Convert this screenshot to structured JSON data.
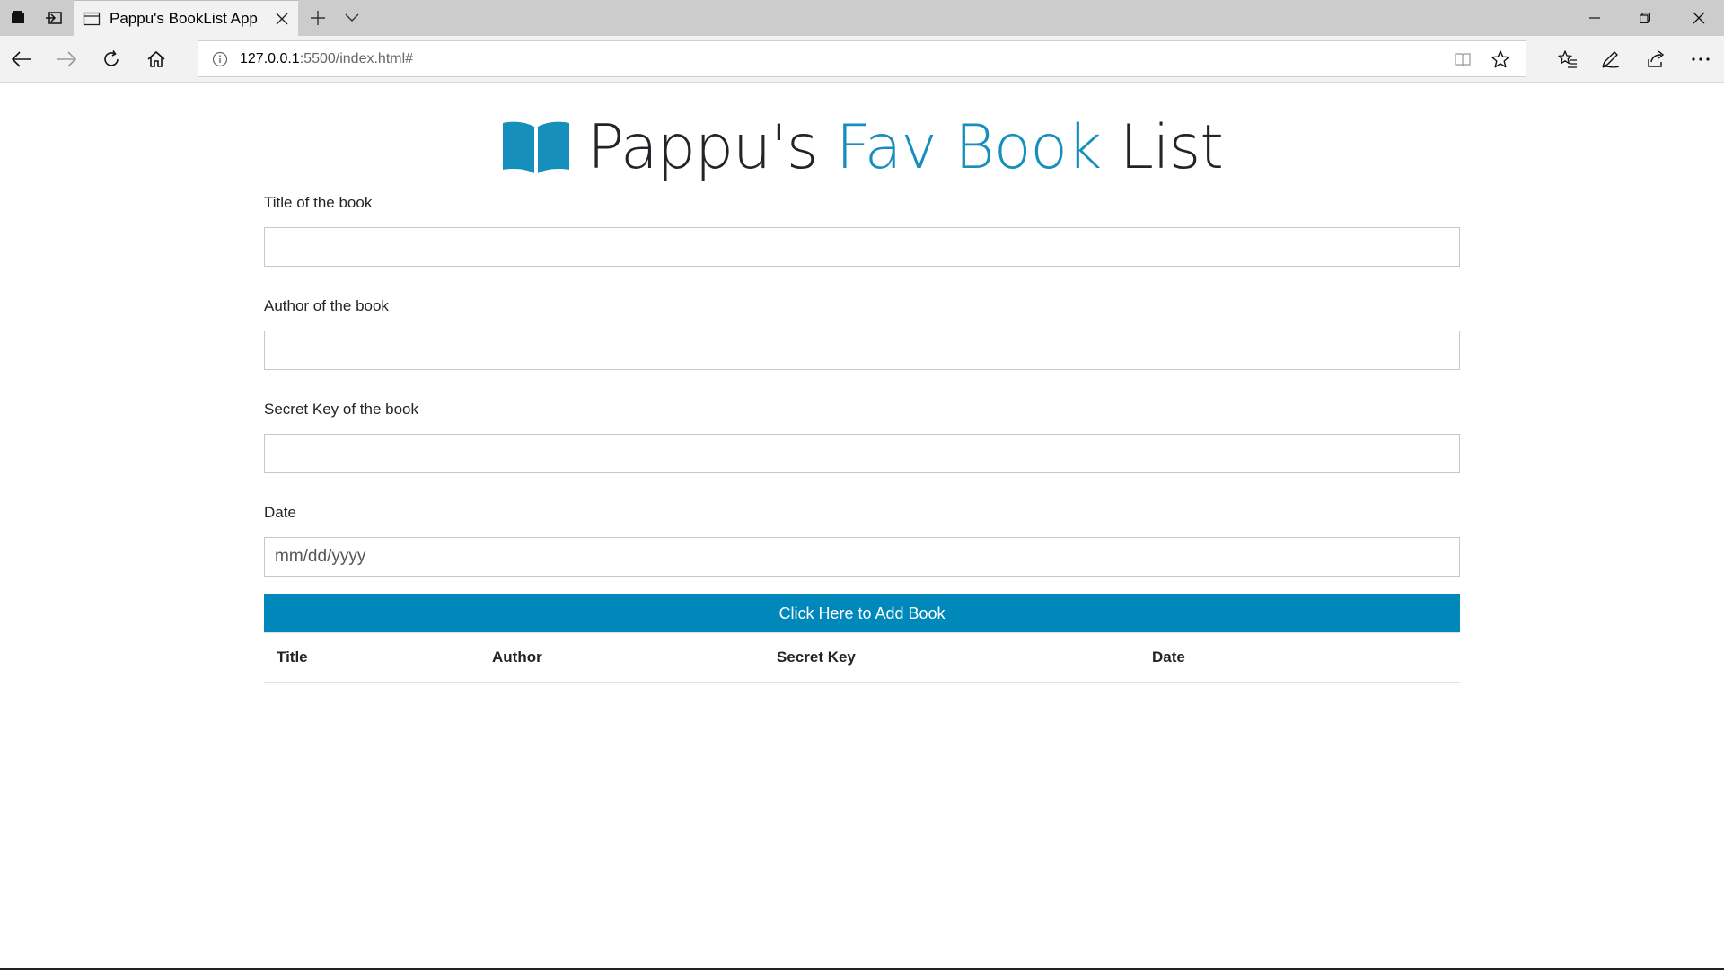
{
  "browser": {
    "tab_title": "Pappu's BookList App",
    "address_host": "127.0.0.1",
    "address_path": ":5500/index.html#"
  },
  "page": {
    "heading": {
      "part1": "Pappu's",
      "part2": "Fav Book",
      "part3": "List",
      "accent_color": "#168fbd"
    },
    "form": {
      "title_label": "Title of the book",
      "author_label": "Author of the book",
      "secret_label": "Secret Key of the book",
      "date_label": "Date",
      "date_placeholder": "mm/dd/yyyy",
      "submit_label": "Click Here to Add Book",
      "submit_color": "#0088bb"
    },
    "table": {
      "headers": [
        "Title",
        "Author",
        "Secret Key",
        "Date"
      ]
    }
  }
}
